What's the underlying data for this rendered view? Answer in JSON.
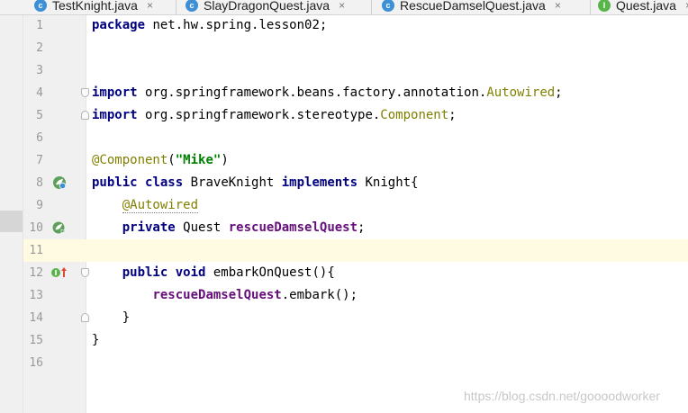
{
  "tabs": [
    {
      "label": "TestKnight.java",
      "icon": "class-icon",
      "close": "×"
    },
    {
      "label": "SlayDragonQuest.java",
      "icon": "class-icon",
      "close": "×"
    },
    {
      "label": "RescueDamselQuest.java",
      "icon": "class-icon",
      "close": "×"
    },
    {
      "label": "Quest.java",
      "icon": "interface-icon",
      "close": "×"
    }
  ],
  "editor": {
    "current_line": 11,
    "line_numbers": [
      "1",
      "2",
      "3",
      "4",
      "5",
      "6",
      "7",
      "8",
      "9",
      "10",
      "11",
      "12",
      "13",
      "14",
      "15",
      "16"
    ],
    "lines": {
      "l1": {
        "kw": "package",
        "rest": " net.hw.spring.lesson02;"
      },
      "l4": {
        "kw": "import",
        "pre": " org.springframework.beans.factory.annotation.",
        "ref": "Autowired",
        "post": ";"
      },
      "l5": {
        "kw": "import",
        "pre": " org.springframework.stereotype.",
        "ref": "Component",
        "post": ";"
      },
      "l7": {
        "ann": "@Component",
        "open": "(",
        "str": "\"Mike\"",
        "close": ")"
      },
      "l8": {
        "kw1": "public",
        "kw2": "class",
        "name": " BraveKnight ",
        "kw3": "implements",
        "rest": " Knight{"
      },
      "l9": {
        "indent": "    ",
        "ann": "@Autowired"
      },
      "l10": {
        "indent": "    ",
        "kw": "private",
        "type": " Quest ",
        "fld": "rescueDamselQuest",
        "post": ";"
      },
      "l12": {
        "indent": "    ",
        "kw1": "public",
        "kw2": "void",
        "rest": " embarkOnQuest(){"
      },
      "l13": {
        "indent": "        ",
        "fld": "rescueDamselQuest",
        "post": ".embark();"
      },
      "l14": {
        "indent": "    ",
        "rest": "}"
      },
      "l15": {
        "rest": "}"
      }
    }
  },
  "gutter_icons": {
    "l8": "spring-bean-icon",
    "l10": "spring-bean-autowired-icon",
    "l12": "implements-method-icon"
  },
  "watermark": "https://blog.csdn.net/goooodworker",
  "colors": {
    "keyword": "#000080",
    "annotation": "#808000",
    "string": "#008000",
    "field": "#660e7a",
    "line_number": "#999999",
    "current_line_bg": "#fffbe2",
    "gutter_bg": "#f0f0f0"
  }
}
